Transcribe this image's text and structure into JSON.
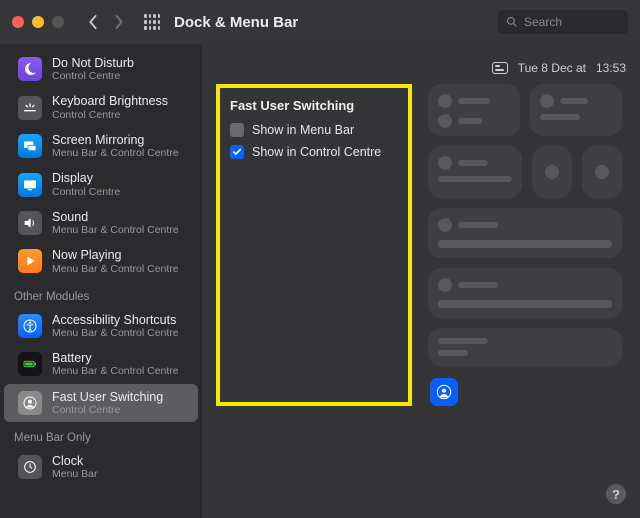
{
  "window": {
    "title": "Dock & Menu Bar",
    "search_placeholder": "Search"
  },
  "statusbar": {
    "date": "Tue 8 Dec at",
    "time": "13:53"
  },
  "sidebar": {
    "items": [
      {
        "title": "Do Not Disturb",
        "sub": "Control Centre"
      },
      {
        "title": "Keyboard Brightness",
        "sub": "Control Centre"
      },
      {
        "title": "Screen Mirroring",
        "sub": "Menu Bar & Control Centre"
      },
      {
        "title": "Display",
        "sub": "Control Centre"
      },
      {
        "title": "Sound",
        "sub": "Menu Bar & Control Centre"
      },
      {
        "title": "Now Playing",
        "sub": "Menu Bar & Control Centre"
      }
    ],
    "section_other": "Other Modules",
    "other_items": [
      {
        "title": "Accessibility Shortcuts",
        "sub": "Menu Bar & Control Centre"
      },
      {
        "title": "Battery",
        "sub": "Menu Bar & Control Centre"
      },
      {
        "title": "Fast User Switching",
        "sub": "Control Centre"
      }
    ],
    "section_menubar": "Menu Bar Only",
    "menubar_items": [
      {
        "title": "Clock",
        "sub": "Menu Bar"
      }
    ]
  },
  "pane": {
    "title": "Fast User Switching",
    "opt_menubar": "Show in Menu Bar",
    "opt_cc": "Show in Control Centre",
    "menubar_checked": false,
    "cc_checked": true
  },
  "help_label": "?"
}
